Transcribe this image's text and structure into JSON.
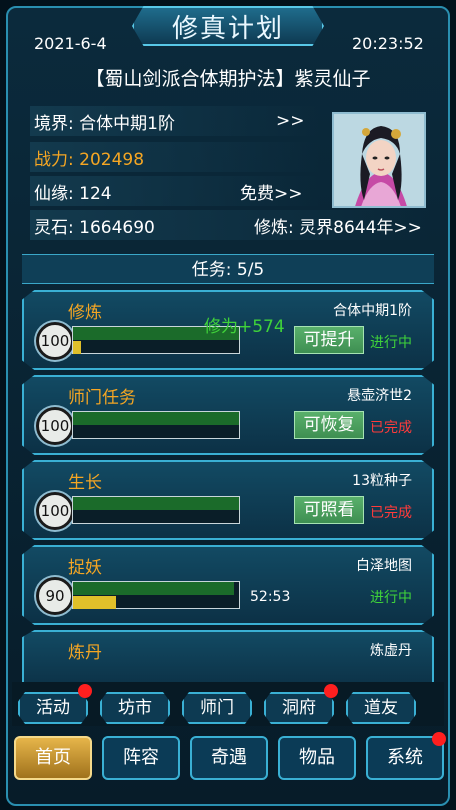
{
  "header": {
    "title": "修真计划",
    "date": "2021-6-4",
    "time": "20:23:52"
  },
  "character": {
    "title_line": "【蜀山剑派合体期护法】紫灵仙子",
    "realm": "境界: 合体中期1阶",
    "realm_action": ">>",
    "power": "战力: 202498",
    "fate": "仙缘: 124",
    "fate_action": "免费>>",
    "stones": "灵石: 1664690",
    "cultivation": "修炼: 灵界8644年>>"
  },
  "tasks": {
    "header": "任务: 5/5",
    "floating_text": "修为+574",
    "cards": [
      {
        "name": "修炼",
        "level": "100",
        "right": "合体中期1阶",
        "action": "可提升",
        "status": "进行中",
        "progress_top": 1.0,
        "progress_bottom": 0.05
      },
      {
        "name": "师门任务",
        "level": "100",
        "right": "悬壶济世2",
        "action": "可恢复",
        "status": "已完成",
        "progress_top": 1.0,
        "progress_bottom": 0
      },
      {
        "name": "生长",
        "level": "100",
        "right": "13粒种子",
        "action": "可照看",
        "status": "已完成",
        "progress_top": 1.0,
        "progress_bottom": 0
      },
      {
        "name": "捉妖",
        "level": "90",
        "right": "白泽地图",
        "timer": "52:53",
        "status": "进行中",
        "progress_top": 0.97,
        "progress_bottom": 0.26
      },
      {
        "name": "炼丹",
        "right": "炼虚丹"
      }
    ]
  },
  "subnav": [
    "活动",
    "坊市",
    "师门",
    "洞府",
    "道友"
  ],
  "mainnav": [
    "首页",
    "阵容",
    "奇遇",
    "物品",
    "系统"
  ],
  "colors": {
    "gold": "#f5a623",
    "status_ok": "#3fd23a",
    "status_done": "#ff3b3b",
    "accent": "#3ab0d4"
  }
}
